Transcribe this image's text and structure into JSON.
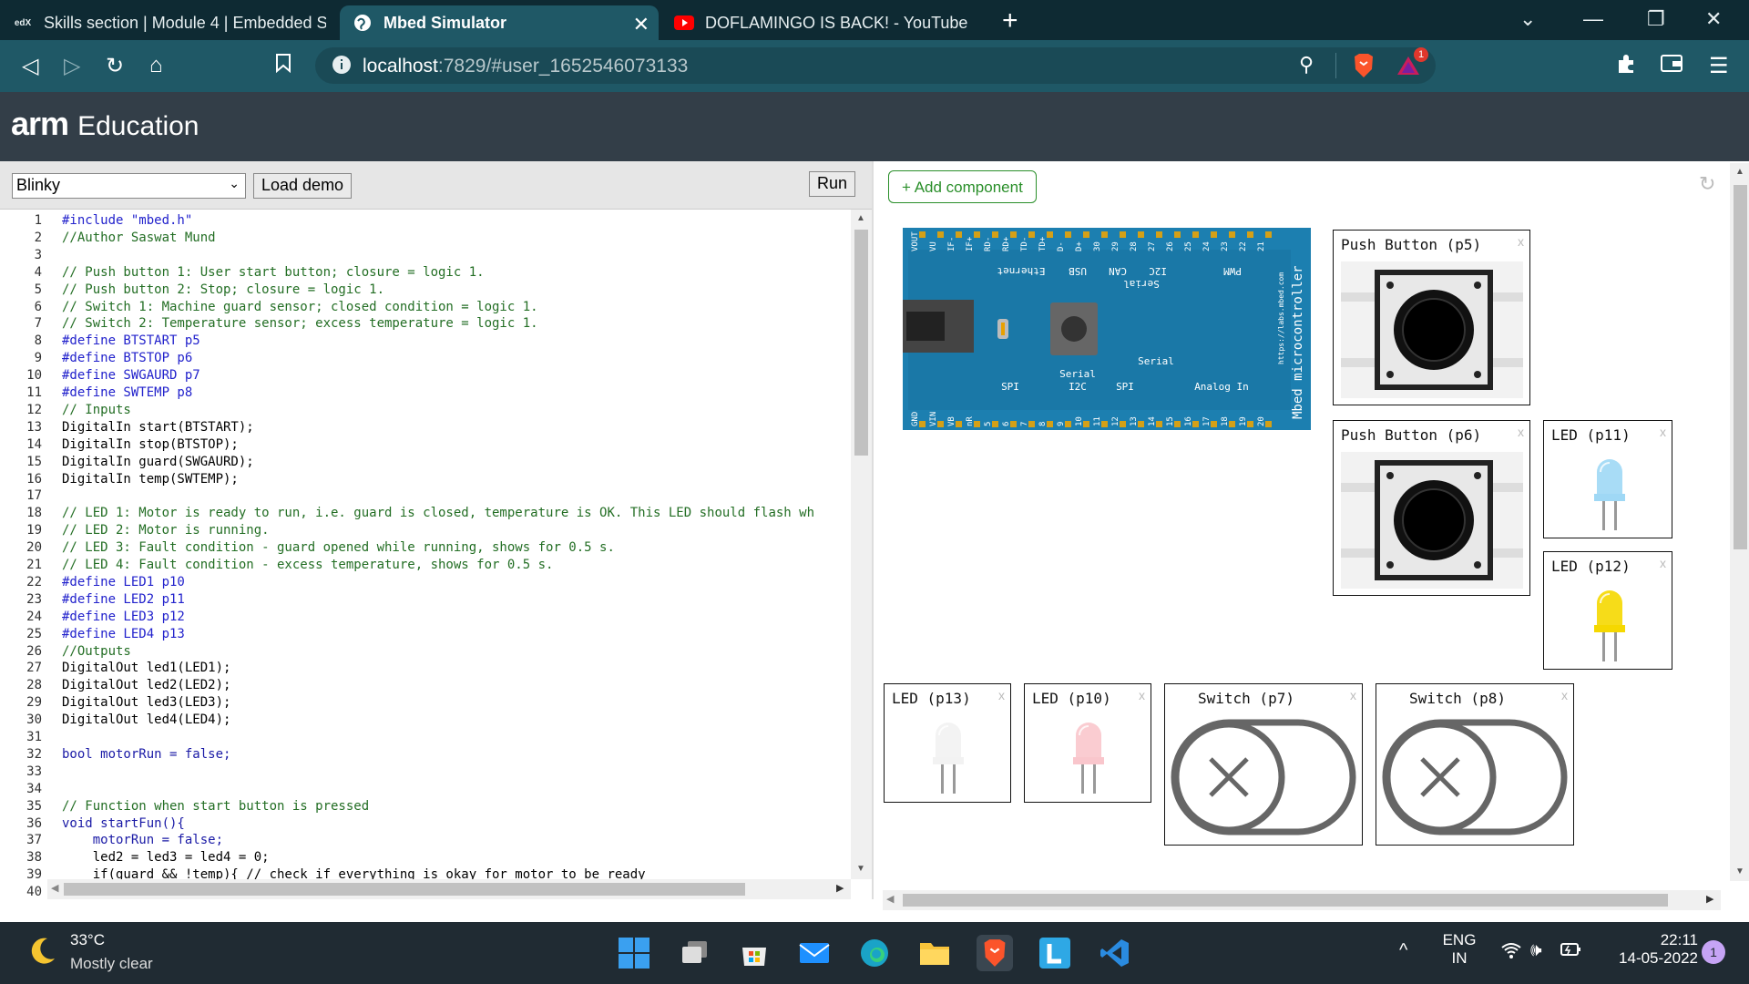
{
  "browser": {
    "tabs": [
      {
        "favicon": "edX",
        "title": "Skills section | Module 4 | Embedded S"
      },
      {
        "favicon": "mbed",
        "title": "Mbed Simulator"
      },
      {
        "favicon": "youtube",
        "title": "DOFLAMINGO IS BACK! - YouTube"
      }
    ],
    "url_host": "localhost",
    "url_rest": ":7829/#user_1652546073133",
    "brave_badge": "1"
  },
  "header": {
    "logo_bold": "arm",
    "logo_text": "Education"
  },
  "editor": {
    "demo_selected": "Blinky",
    "load_demo_label": "Load demo",
    "run_label": "Run",
    "lines": [
      {
        "n": "1",
        "t": "#include \"mbed.h\"",
        "c": "pp"
      },
      {
        "n": "2",
        "t": "//Author Saswat Mund",
        "c": "cm"
      },
      {
        "n": "3",
        "t": "",
        "c": ""
      },
      {
        "n": "4",
        "t": "// Push button 1: User start button; closure = logic 1.",
        "c": "cm"
      },
      {
        "n": "5",
        "t": "// Push button 2: Stop; closure = logic 1.",
        "c": "cm"
      },
      {
        "n": "6",
        "t": "// Switch 1: Machine guard sensor; closed condition = logic 1.",
        "c": "cm"
      },
      {
        "n": "7",
        "t": "// Switch 2: Temperature sensor; excess temperature = logic 1.",
        "c": "cm"
      },
      {
        "n": "8",
        "t": "#define BTSTART p5",
        "c": "pp"
      },
      {
        "n": "9",
        "t": "#define BTSTOP p6",
        "c": "pp"
      },
      {
        "n": "10",
        "t": "#define SWGAURD p7",
        "c": "pp"
      },
      {
        "n": "11",
        "t": "#define SWTEMP p8",
        "c": "pp"
      },
      {
        "n": "12",
        "t": "// Inputs",
        "c": "cm"
      },
      {
        "n": "13",
        "t": "DigitalIn start(BTSTART);",
        "c": ""
      },
      {
        "n": "14",
        "t": "DigitalIn stop(BTSTOP);",
        "c": ""
      },
      {
        "n": "15",
        "t": "DigitalIn guard(SWGAURD);",
        "c": ""
      },
      {
        "n": "16",
        "t": "DigitalIn temp(SWTEMP);",
        "c": ""
      },
      {
        "n": "17",
        "t": "",
        "c": ""
      },
      {
        "n": "18",
        "t": "// LED 1: Motor is ready to run, i.e. guard is closed, temperature is OK. This LED should flash wh",
        "c": "cm"
      },
      {
        "n": "19",
        "t": "// LED 2: Motor is running.",
        "c": "cm"
      },
      {
        "n": "20",
        "t": "// LED 3: Fault condition - guard opened while running, shows for 0.5 s.",
        "c": "cm"
      },
      {
        "n": "21",
        "t": "// LED 4: Fault condition - excess temperature, shows for 0.5 s.",
        "c": "cm"
      },
      {
        "n": "22",
        "t": "#define LED1 p10",
        "c": "pp"
      },
      {
        "n": "23",
        "t": "#define LED2 p11",
        "c": "pp"
      },
      {
        "n": "24",
        "t": "#define LED3 p12",
        "c": "pp"
      },
      {
        "n": "25",
        "t": "#define LED4 p13",
        "c": "pp"
      },
      {
        "n": "26",
        "t": "//Outputs",
        "c": "cm"
      },
      {
        "n": "27",
        "t": "DigitalOut led1(LED1);",
        "c": ""
      },
      {
        "n": "28",
        "t": "DigitalOut led2(LED2);",
        "c": ""
      },
      {
        "n": "29",
        "t": "DigitalOut led3(LED3);",
        "c": ""
      },
      {
        "n": "30",
        "t": "DigitalOut led4(LED4);",
        "c": ""
      },
      {
        "n": "31",
        "t": "",
        "c": ""
      },
      {
        "n": "32",
        "t": "bool motorRun = false;",
        "c": "kw"
      },
      {
        "n": "33",
        "t": "",
        "c": ""
      },
      {
        "n": "34",
        "t": "",
        "c": ""
      },
      {
        "n": "35",
        "t": "// Function when start button is pressed",
        "c": "cm"
      },
      {
        "n": "36",
        "t": "void startFun(){",
        "c": "kw"
      },
      {
        "n": "37",
        "t": "    motorRun = false;",
        "c": "kw"
      },
      {
        "n": "38",
        "t": "    led2 = led3 = led4 = 0;",
        "c": ""
      },
      {
        "n": "39",
        "t": "    if(guard && !temp){ // check if everything is okay for motor to be ready",
        "c": ""
      },
      {
        "n": "40",
        "t": "",
        "c": ""
      }
    ]
  },
  "simulator": {
    "add_component_label": "+ Add component",
    "components": [
      {
        "label": "Push Button (p5)",
        "type": "button"
      },
      {
        "label": "Push Button (p6)",
        "type": "button"
      },
      {
        "label": "LED (p11)",
        "type": "led",
        "color": "#9fd8f5"
      },
      {
        "label": "LED (p12)",
        "type": "led",
        "color": "#f5d800"
      },
      {
        "label": "LED (p13)",
        "type": "led",
        "color": "#f2f2f2"
      },
      {
        "label": "LED (p10)",
        "type": "led",
        "color": "#f9c6cc"
      },
      {
        "label": "Switch (p7)",
        "type": "switch"
      },
      {
        "label": "Switch (p8)",
        "type": "switch"
      }
    ],
    "board": {
      "top_pins": [
        "VOUT",
        "VU",
        "IF-",
        "IF+",
        "RD-",
        "RD+",
        "TD-",
        "TD+",
        "D-",
        "D+",
        "30",
        "29",
        "28",
        "27",
        "26",
        "25",
        "24",
        "23",
        "22",
        "21"
      ],
      "bottom_pins": [
        "GND",
        "VIN",
        "VB",
        "nR",
        "5",
        "6",
        "7",
        "8",
        "9",
        "10",
        "11",
        "12",
        "13",
        "14",
        "15",
        "16",
        "17",
        "18",
        "19",
        "20"
      ],
      "labels_top": [
        "Ethernet",
        "USB",
        "CAN",
        "I2C",
        "PWM",
        "Serial"
      ],
      "labels_bottom": [
        "SPI",
        "Serial",
        "I2C",
        "SPI",
        "Serial",
        "Analog In"
      ],
      "side_text": "Mbed microcontroller",
      "url_text": "https://labs.mbed.com"
    }
  },
  "taskbar": {
    "temperature": "33°C",
    "weather": "Mostly clear",
    "lang_1": "ENG",
    "lang_2": "IN",
    "time": "22:11",
    "date": "14-05-2022",
    "notification_count": "1"
  }
}
